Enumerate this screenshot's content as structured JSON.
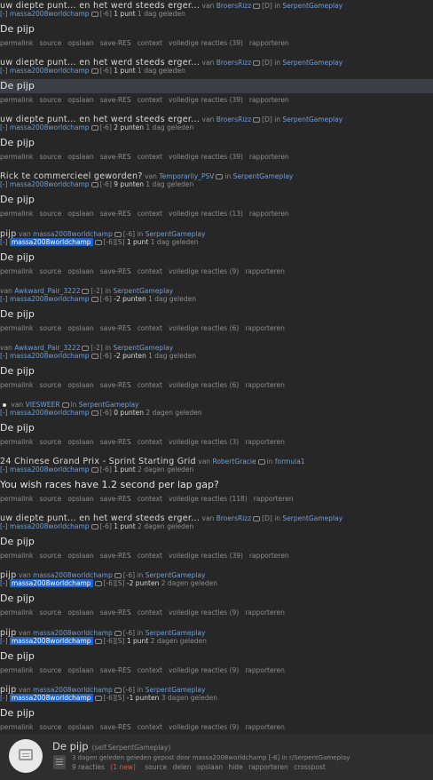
{
  "comments": [
    {
      "kind": "A",
      "title": "uw diepte punt... en het werd steeds erger...",
      "by": "van",
      "author": "BroersRizz",
      "flair": "[D]",
      "in": "in",
      "subreddit": "SerpentGameplay",
      "collapse": "[-]",
      "user": "massa2008worldchamp",
      "score_flair": "[-6]",
      "points": "1 punt",
      "age": "1 dag geleden",
      "body": "De pijp",
      "links": [
        "permalink",
        "source",
        "opslaan",
        "save-RES",
        "context",
        "volledige reacties (39)",
        "rapporteren"
      ]
    },
    {
      "kind": "A",
      "title": "uw diepte punt... en het werd steeds erger...",
      "by": "van",
      "author": "BroersRizz",
      "flair": "[D]",
      "in": "in",
      "subreddit": "SerpentGameplay",
      "collapse": "[-]",
      "user": "massa2008worldchamp",
      "score_flair": "[-6]",
      "points": "1 punt",
      "age": "1 dag geleden",
      "body": "De pijp",
      "highlight": true,
      "links": [
        "permalink",
        "source",
        "opslaan",
        "save-RES",
        "context",
        "volledige reacties (39)",
        "rapporteren"
      ]
    },
    {
      "kind": "A",
      "title": "uw diepte punt... en het werd steeds erger...",
      "by": "van",
      "author": "BroersRizz",
      "flair": "[D]",
      "in": "in",
      "subreddit": "SerpentGameplay",
      "collapse": "[-]",
      "user": "massa2008worldchamp",
      "score_flair": "[-6]",
      "points": "2 punten",
      "age": "1 dag geleden",
      "body": "De pijp",
      "links": [
        "permalink",
        "source",
        "opslaan",
        "save-RES",
        "context",
        "volledige reacties (39)",
        "rapporteren"
      ]
    },
    {
      "kind": "A",
      "title": "Rick te commercieel geworden?",
      "by": "van",
      "author": "Temporarily_PSV",
      "flair": "",
      "in": "in",
      "subreddit": "SerpentGameplay",
      "collapse": "[-]",
      "user": "massa2008worldchamp",
      "score_flair": "[-6]",
      "points": "9 punten",
      "age": "1 dag geleden",
      "body": "De pijp",
      "links": [
        "permalink",
        "source",
        "opslaan",
        "save-RES",
        "context",
        "volledige reacties (13)",
        "rapporteren"
      ]
    },
    {
      "kind": "B",
      "title": "pijp",
      "by": "van",
      "author": "massa2008worldchamp",
      "flair": "[-6]",
      "in": "in",
      "subreddit": "SerpentGameplay",
      "collapse": "[-]",
      "user": "massa2008worldchamp",
      "score_flair": "[-6][S]",
      "points": "1 punt",
      "age": "1 dag geleden",
      "body": "De pijp",
      "links": [
        "permalink",
        "source",
        "opslaan",
        "save-RES",
        "context",
        "volledige reacties (9)",
        "rapporteren"
      ]
    },
    {
      "kind": "C",
      "title": "",
      "by": "van",
      "author": "Awkward_Pair_3222",
      "flair": "[-2]",
      "in": "in",
      "subreddit": "SerpentGameplay",
      "collapse": "[-]",
      "user": "massa2008worldchamp",
      "score_flair": "[-6]",
      "points": "-2 punten",
      "age": "1 dag geleden",
      "body": "De pijp",
      "links": [
        "permalink",
        "source",
        "opslaan",
        "save-RES",
        "context",
        "volledige reacties (6)",
        "rapporteren"
      ]
    },
    {
      "kind": "C",
      "title": "",
      "by": "van",
      "author": "Awkward_Pair_3222",
      "flair": "[-2]",
      "in": "in",
      "subreddit": "SerpentGameplay",
      "collapse": "[-]",
      "user": "massa2008worldchamp",
      "score_flair": "[-6]",
      "points": "-2 punten",
      "age": "1 dag geleden",
      "body": "De pijp",
      "links": [
        "permalink",
        "source",
        "opslaan",
        "save-RES",
        "context",
        "volledige reacties (6)",
        "rapporteren"
      ]
    },
    {
      "kind": "D",
      "title": "",
      "by": "van",
      "author": "VIESWEER",
      "flair": "",
      "in": "in",
      "subreddit": "SerpentGameplay",
      "collapse": "[-]",
      "user": "massa2008worldchamp",
      "score_flair": "[-6]",
      "points": "0 punten",
      "age": "2 dagen geleden",
      "body": "De pijp",
      "links": [
        "permalink",
        "source",
        "opslaan",
        "save-RES",
        "context",
        "volledige reacties (3)",
        "rapporteren"
      ]
    },
    {
      "kind": "A",
      "title": "24 Chinese Grand Prix - Sprint Starting Grid",
      "by": "van",
      "author": "RobertGracie",
      "flair": "",
      "in": "in",
      "subreddit": "formula1",
      "collapse": "[-]",
      "user": "massa2008worldchamp",
      "score_flair": "[-6]",
      "points": "1 punt",
      "age": "2 dagen geleden",
      "body": "You wish races have 1.2 second per lap gap?",
      "links": [
        "permalink",
        "source",
        "opslaan",
        "save-RES",
        "context",
        "volledige reacties (118)",
        "rapporteren"
      ]
    },
    {
      "kind": "A",
      "title": "uw diepte punt... en het werd steeds erger...",
      "by": "van",
      "author": "BroersRizz",
      "flair": "[D]",
      "in": "in",
      "subreddit": "SerpentGameplay",
      "collapse": "[-]",
      "user": "massa2008worldchamp",
      "score_flair": "[-6]",
      "points": "1 punt",
      "age": "2 dagen geleden",
      "body": "De pijp",
      "links": [
        "permalink",
        "source",
        "opslaan",
        "save-RES",
        "context",
        "volledige reacties (39)",
        "rapporteren"
      ]
    },
    {
      "kind": "B",
      "title": "pijp",
      "by": "van",
      "author": "massa2008worldchamp",
      "flair": "[-6]",
      "in": "in",
      "subreddit": "SerpentGameplay",
      "collapse": "[-]",
      "user": "massa2008worldchamp",
      "score_flair": "[-6][S]",
      "points": "-2 punten",
      "age": "2 dagen geleden",
      "body": "De pijp",
      "links": [
        "permalink",
        "source",
        "opslaan",
        "save-RES",
        "context",
        "volledige reacties (9)",
        "rapporteren"
      ]
    },
    {
      "kind": "B",
      "title": "pijp",
      "by": "van",
      "author": "massa2008worldchamp",
      "flair": "[-6]",
      "in": "in",
      "subreddit": "SerpentGameplay",
      "collapse": "[-]",
      "user": "massa2008worldchamp",
      "score_flair": "[-6][S]",
      "points": "1 punt",
      "age": "2 dagen geleden",
      "body": "De pijp",
      "links": [
        "permalink",
        "source",
        "opslaan",
        "save-RES",
        "context",
        "volledige reacties (9)",
        "rapporteren"
      ]
    },
    {
      "kind": "B",
      "title": "pijp",
      "by": "van",
      "author": "massa2008worldchamp",
      "flair": "[-6]",
      "in": "in",
      "subreddit": "SerpentGameplay",
      "collapse": "[-]",
      "user": "massa2008worldchamp",
      "score_flair": "[-6][S]",
      "points": "-1 punten",
      "age": "3 dagen geleden",
      "body": "De pijp",
      "links": [
        "permalink",
        "source",
        "opslaan",
        "save-RES",
        "context",
        "volledige reacties (9)",
        "rapporteren"
      ]
    }
  ],
  "footer": {
    "title": "De pijp",
    "domain": "(self.SerpentGameplay)",
    "meta": "3 dagen geleden geleden gepost door massa2008worldchamp [-6] in r/SerpentGameplay",
    "reactions": "9 reacties",
    "new": "(1 new)",
    "links": [
      "source",
      "delen",
      "opslaan",
      "hide",
      "rapporteren",
      "crosspost"
    ]
  }
}
